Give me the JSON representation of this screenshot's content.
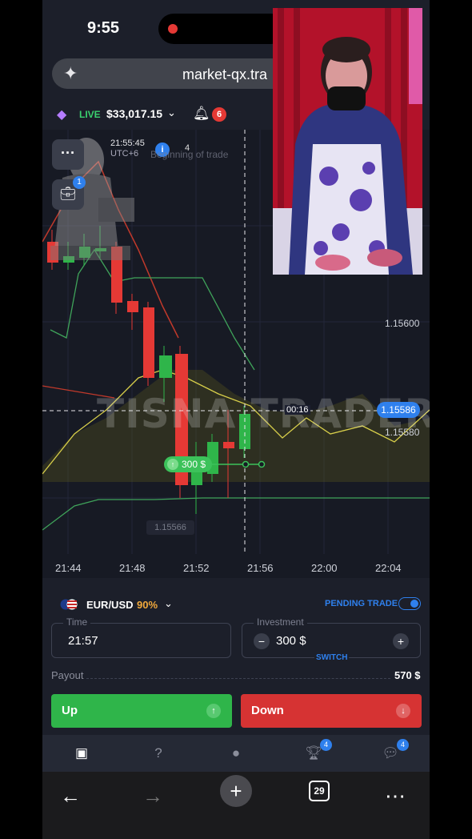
{
  "status_bar": {
    "time": "9:55"
  },
  "browser": {
    "url": "market-qx.tra",
    "tab_count": "29"
  },
  "account": {
    "mode": "LIVE",
    "balance": "$33,017.15",
    "notifications": "6"
  },
  "chart": {
    "clock": "21:55:45",
    "timezone": "UTC+6",
    "info_badge": "i",
    "info_count": "4",
    "beginning_label": "Beginning of trade",
    "briefcase_badge": "1",
    "price_labels": [
      "1.15600",
      "1.15580"
    ],
    "current_price": "1.15586",
    "countdown": "00:16",
    "trade_amount": "300 $",
    "low_price": "1.15566",
    "watermark": "TISNA TRADER",
    "x_ticks": [
      "21:44",
      "21:48",
      "21:52",
      "21:56",
      "22:00",
      "22:04"
    ]
  },
  "chart_data": {
    "type": "candlestick",
    "pair": "EUR/USD",
    "x": [
      "21:44",
      "21:48",
      "21:52",
      "21:56",
      "22:00",
      "22:04"
    ],
    "price_labels": [
      1.156,
      1.1558
    ],
    "current_price": 1.15586,
    "trade_marker": {
      "amount": "300 $",
      "direction": "up"
    }
  },
  "trade": {
    "pair": "EUR/USD",
    "payout_pct": "90%",
    "pending_label": "PENDING TRADE",
    "time_label": "Time",
    "time_value": "21:57",
    "investment_label": "Investment",
    "investment_value": "300 $",
    "minus": "−",
    "plus": "+",
    "switch_label": "SWITCH",
    "payout_label": "Payout",
    "payout_value": "570 $",
    "up_label": "Up",
    "down_label": "Down"
  },
  "app_nav": {
    "trophy_badge": "4",
    "chat_badge": "4"
  },
  "colors": {
    "accent": "#2f80ed",
    "up": "#2fb54a",
    "down": "#d63333",
    "bg": "#1c1f2a"
  }
}
